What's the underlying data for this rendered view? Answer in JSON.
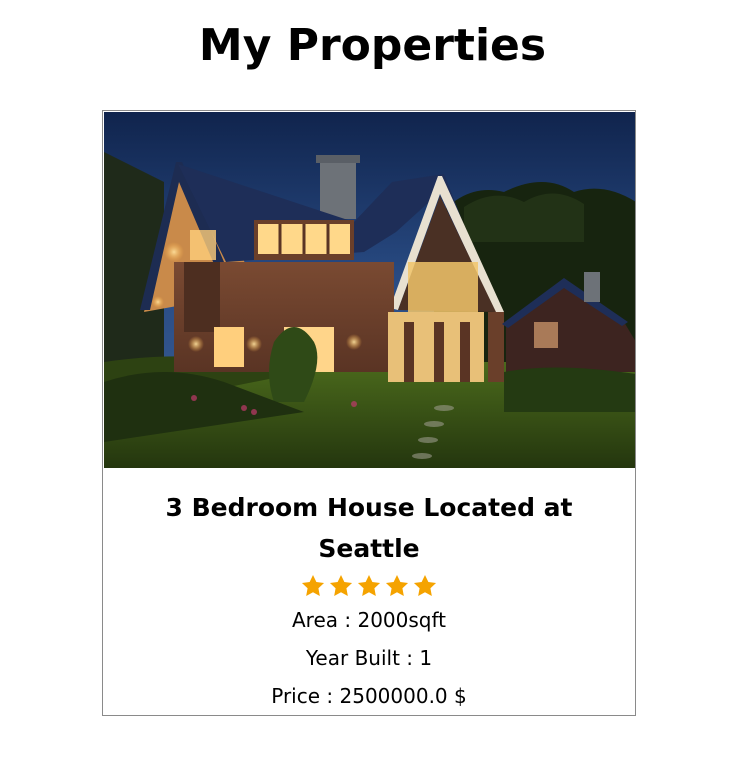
{
  "page": {
    "title": "My Properties"
  },
  "property": {
    "title": "3 Bedroom House Located at Seattle",
    "rating": 5,
    "rating_max": 5,
    "area_text": "Area : 2000sqft",
    "year_text": "Year Built : 1",
    "price_text": "Price : 2500000.0 $"
  },
  "colors": {
    "star": "#f5a300",
    "card_border": "#8a8a8a",
    "sky": "#1d3a6e"
  },
  "icons": {
    "star": "star-icon"
  }
}
